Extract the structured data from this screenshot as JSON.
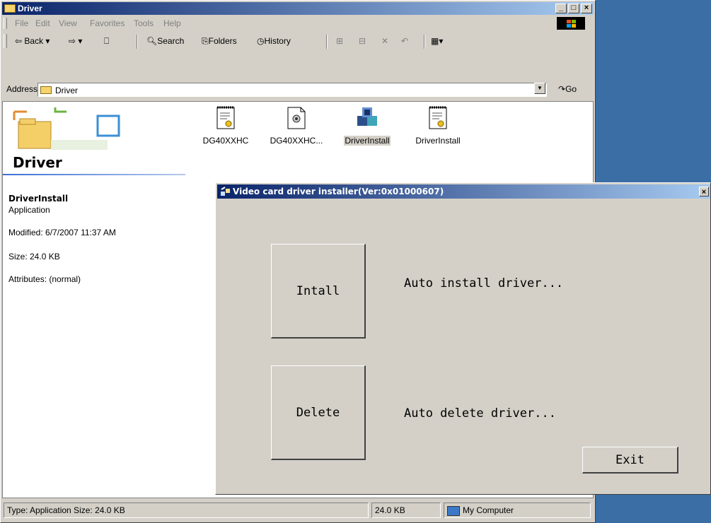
{
  "explorer": {
    "title": "Driver",
    "menu": [
      "File",
      "Edit",
      "View",
      "Favorites",
      "Tools",
      "Help"
    ],
    "toolbar": {
      "back": "Back",
      "search": "Search",
      "folders": "Folders",
      "history": "History"
    },
    "address": {
      "label": "Address",
      "value": "Driver",
      "go": "Go"
    },
    "sidebar": {
      "folder_title": "Driver",
      "selected_name": "DriverInstall",
      "selected_type": "Application",
      "modified": "Modified: 6/7/2007 11:37 AM",
      "size": "Size: 24.0 KB",
      "attributes": "Attributes: (normal)"
    },
    "files": [
      {
        "label": "DG40XXHC",
        "icon": "text-document-icon"
      },
      {
        "label": "DG40XXHC...",
        "icon": "settings-file-icon"
      },
      {
        "label": "DriverInstall",
        "icon": "application-blocks-icon"
      },
      {
        "label": "DriverInstall",
        "icon": "text-document-icon"
      }
    ],
    "status": {
      "info": "Type: Application Size: 24.0 KB",
      "size": "24.0 KB",
      "zone": "My Computer"
    }
  },
  "installer": {
    "title": "Video card driver installer(Ver:0x01000607)",
    "install_button": "Intall",
    "install_desc": "Auto install driver...",
    "delete_button": "Delete",
    "delete_desc": "Auto delete driver...",
    "exit_button": "Exit"
  },
  "colors": {
    "titlebar_start": "#0a246a",
    "titlebar_end": "#a6caf0",
    "desktop": "#3a6ea5",
    "face": "#d4d0c8"
  }
}
